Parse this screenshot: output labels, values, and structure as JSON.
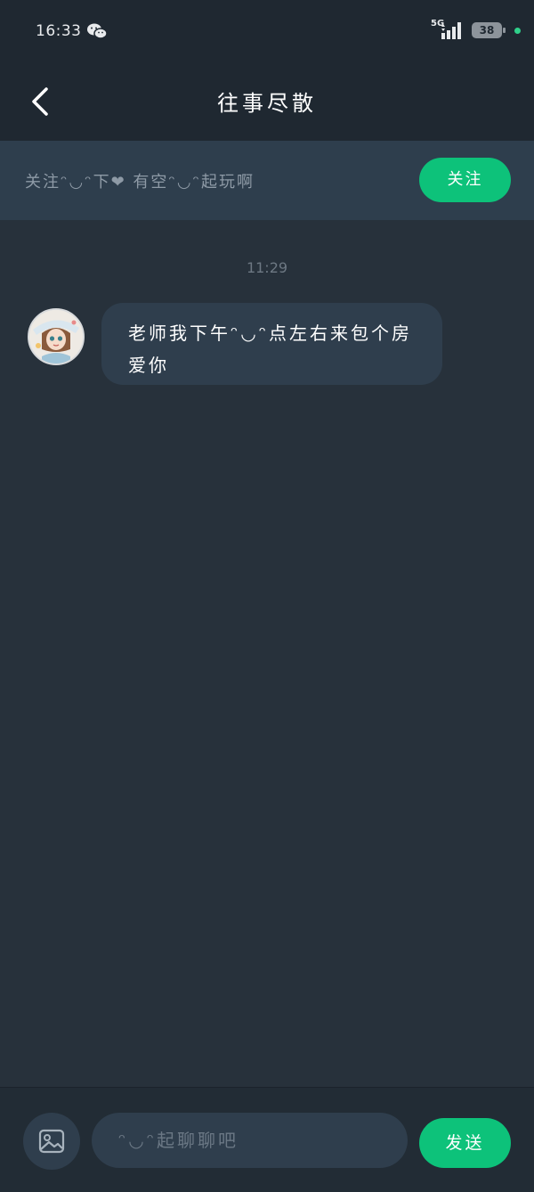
{
  "status_bar": {
    "time": "16:33",
    "network": "5G",
    "battery": "38",
    "icons": [
      "wechat-icon",
      "signal-icon",
      "battery-icon"
    ]
  },
  "header": {
    "title": "往事尽散",
    "back_icon": "chevron-left-icon"
  },
  "follow_banner": {
    "text": "关注ᵔ◡ᵔ下❤ 有空ᵔ◡ᵔ起玩啊",
    "button_label": "关注",
    "button_color": "#0dc27a"
  },
  "chat": {
    "timestamp": "11:29",
    "messages": [
      {
        "sender": "other",
        "avatar_icon": "user-avatar",
        "text": "老师我下午ᵔ◡ᵔ点左右来包个房爱你"
      }
    ]
  },
  "input_bar": {
    "image_icon": "image-icon",
    "placeholder": "ᵔ◡ᵔ起聊聊吧",
    "send_label": "发送"
  },
  "colors": {
    "background": "#27313b",
    "accent": "#0dc27a",
    "bubble": "#2f3e4d"
  }
}
